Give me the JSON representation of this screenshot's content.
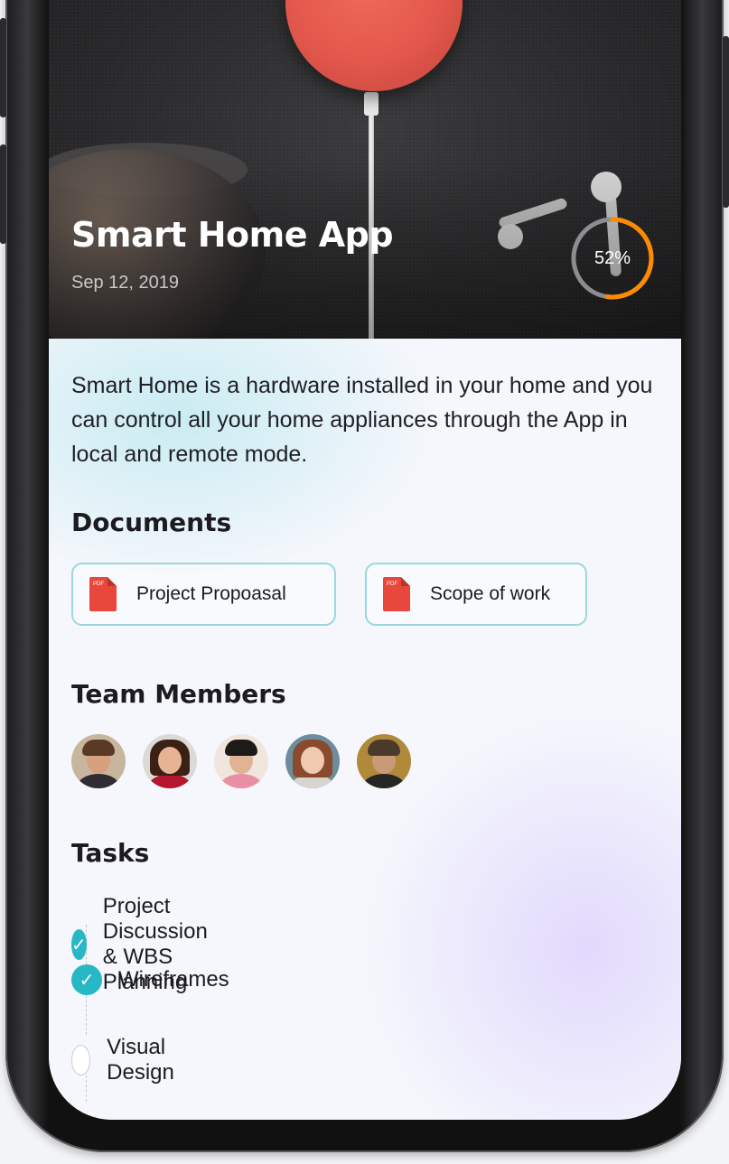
{
  "hero": {
    "title": "Smart Home App",
    "date": "Sep 12, 2019",
    "progress_label": "52%",
    "progress_value": 0.52,
    "progress_color": "#ff8a00"
  },
  "description": "Smart Home is a hardware installed in your home and you can control all your home appliances through the App in local and remote mode.",
  "documents": {
    "heading": "Documents",
    "items": [
      {
        "label": "Project Propoasal",
        "icon": "pdf-icon"
      },
      {
        "label": "Scope of work",
        "icon": "pdf-icon"
      }
    ]
  },
  "team": {
    "heading": "Team Members",
    "members": [
      {
        "icon": "avatar"
      },
      {
        "icon": "avatar"
      },
      {
        "icon": "avatar"
      },
      {
        "icon": "avatar"
      },
      {
        "icon": "avatar"
      }
    ]
  },
  "tasks": {
    "heading": "Tasks",
    "items": [
      {
        "label": "Project Discussion & WBS Planning",
        "done": true
      },
      {
        "label": "Wireframes",
        "done": true
      },
      {
        "label": "Visual Design",
        "done": false
      }
    ]
  },
  "colors": {
    "accent": "#27b7c5",
    "progress": "#ff8a00",
    "card_border": "#9ad8dd",
    "pdf": "#e8483b"
  }
}
